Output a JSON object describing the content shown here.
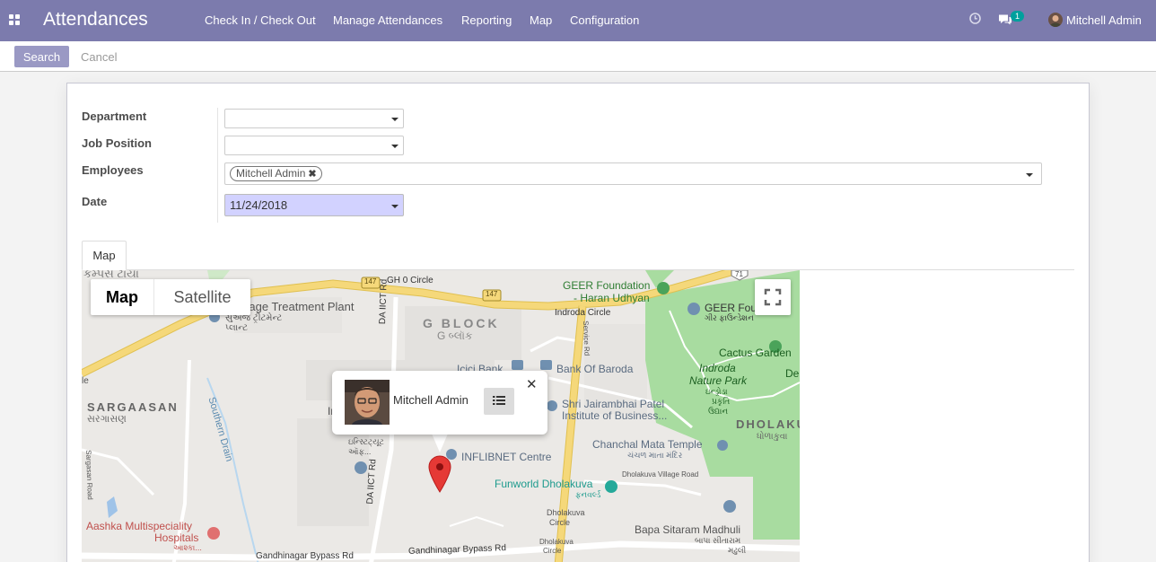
{
  "navbar": {
    "app_title": "Attendances",
    "menu": [
      "Check In / Check Out",
      "Manage Attendances",
      "Reporting",
      "Map",
      "Configuration"
    ],
    "messages_count": "1",
    "user_name": "Mitchell Admin"
  },
  "control_panel": {
    "search_label": "Search",
    "cancel_label": "Cancel"
  },
  "form": {
    "department_label": "Department",
    "department_value": "",
    "job_position_label": "Job Position",
    "job_position_value": "",
    "employees_label": "Employees",
    "employee_tag": "Mitchell Admin",
    "date_label": "Date",
    "date_value": "11/24/2018"
  },
  "tabs": {
    "map_label": "Map"
  },
  "map": {
    "type_map": "Map",
    "type_satellite": "Satellite",
    "popup_name": "Mitchell Admin",
    "labels": {
      "top_left": "કેમ્પસ ટાયા",
      "road_147_a": "147",
      "road_147_b": "147",
      "road_71": "71",
      "gh0": "GH 0 Circle",
      "geer": "GEER Foundation",
      "haran": "- Haran Udhyan",
      "geer_foun": "GEER Foun",
      "geer_guj": "ગીર ફાઉન્ડેશન",
      "indroda_circle": "Indroda Circle",
      "sewage": "wage Treatment Plant",
      "sewage_guj1": "સુએજ ટ્રીટમેન્ટ",
      "sewage_guj2": "પ્લાન્ટ",
      "da_road_top": "DA IICT Rd",
      "g_block": "G BLOCK",
      "g_block_guj": "G બ્લૉક",
      "service_road": "Service Rd",
      "cactus": "Cactus Garden",
      "indroda_park_1": "Indroda",
      "indroda_park_2": "Nature Park",
      "indroda_guj1": "ઇન્ડ્રોડા",
      "indroda_guj2": "પ્રકૃતિ",
      "indroda_guj3": "ઉદ્યાન",
      "de": "De",
      "icici": "Icici Bank",
      "bob": "Bank Of Baroda",
      "jairam1": "Shri Jairambhai Patel",
      "jairam2": "Institute of Business...",
      "dholakuva": "DHOLAKU",
      "dholakuva_guj": "ધોળાકુવા",
      "sargaasan": "SARGAASAN",
      "sargaasan_guj": "સરગાસણ",
      "le": "le",
      "southern_drain": "Southern Drain",
      "in": "In",
      "inst_guj1": "ઇન્સ્ટિટ્યૂટ",
      "inst_guj2": "ઑફ...",
      "inflibnet": "INFLIBNET Centre",
      "chanchal": "Chanchal Mata Temple",
      "chanchal_guj": "ચંચળ માતા મંદિર",
      "dholakuva_village": "Dholakuva Village Road",
      "funworld": "Funworld Dholakuva",
      "funworld_guj": "ફનવર્લ્ડ",
      "dholakuva_circle1": "Dholakuva",
      "dholakuva_circle2": "Circle",
      "sargasan_road": "Sargasan Road",
      "da_road_bottom": "DA IICT Rd",
      "aashka1": "Aashka Multispeciality",
      "aashka2": "Hospitals",
      "aashka_guj": "આશ્કા...",
      "bapa1": "Bapa Sitaram Madhuli",
      "bapa_guj1": "બાપા સીતારામ",
      "bapa_guj2": "મઢુલી",
      "gbypass_left": "Gandhinagar Bypass Rd",
      "gbypass_right": "Gandhinagar Bypass Rd",
      "dholakuva_circle_b1": "Dholakuva",
      "dholakuva_circle_b2": "Circle"
    }
  },
  "colors": {
    "navbar": "#7c7bad",
    "primary_button": "#9a99c4",
    "date_highlight": "#d2d2ff",
    "map_road": "#f5d87a",
    "map_park": "#a8dca0",
    "marker": "#e53935",
    "badge": "#00a09d"
  },
  "icons": [
    "apps-icon",
    "clock-icon",
    "chat-icon",
    "fullscreen-icon",
    "list-icon",
    "close-icon",
    "map-marker-icon"
  ]
}
